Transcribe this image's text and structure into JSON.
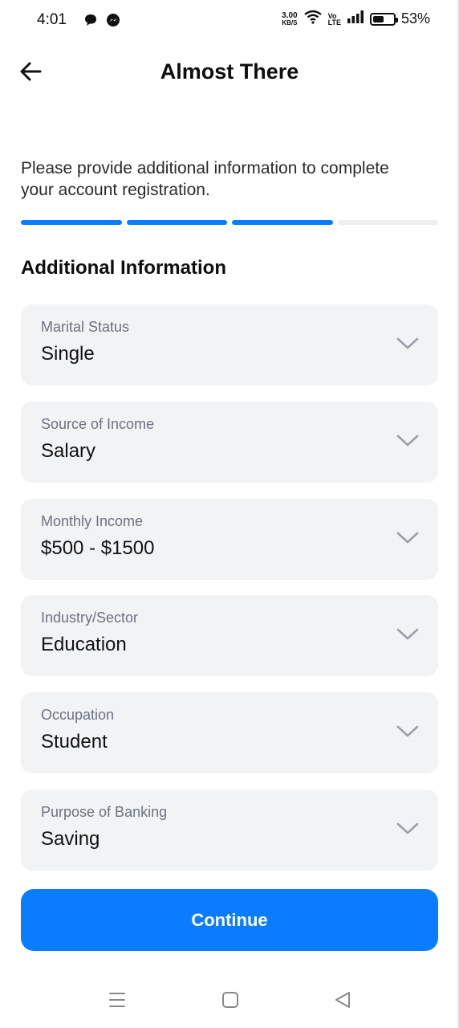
{
  "status_bar": {
    "time": "4:01",
    "speed_value": "3.00",
    "speed_unit": "KB/S",
    "volte_top": "Vo",
    "volte_bottom": "LTE",
    "battery_percent": "53%",
    "battery_level": 0.53,
    "icons": [
      "chat-bubble-icon",
      "messenger-icon",
      "wifi-icon",
      "signal-icon",
      "battery-icon"
    ]
  },
  "header": {
    "title": "Almost There",
    "back_icon": "arrow-left-icon"
  },
  "intro": {
    "text": "Please provide additional information to complete your account registration."
  },
  "progress": {
    "total_steps": 4,
    "completed_steps": 3,
    "active_color": "#0a7cff",
    "inactive_color": "#f0f0f0"
  },
  "section": {
    "title": "Additional Information"
  },
  "fields": [
    {
      "label": "Marital Status",
      "value": "Single"
    },
    {
      "label": "Source of Income",
      "value": "Salary"
    },
    {
      "label": "Monthly Income",
      "value": "$500 - $1500"
    },
    {
      "label": "Industry/Sector",
      "value": "Education"
    },
    {
      "label": "Occupation",
      "value": "Student"
    },
    {
      "label": "Purpose of Banking",
      "value": "Saving"
    }
  ],
  "actions": {
    "continue_label": "Continue",
    "accent": "#0a7cff"
  },
  "nav_bar": {
    "icons": [
      "menu-icon",
      "home-square-icon",
      "back-triangle-icon"
    ]
  }
}
